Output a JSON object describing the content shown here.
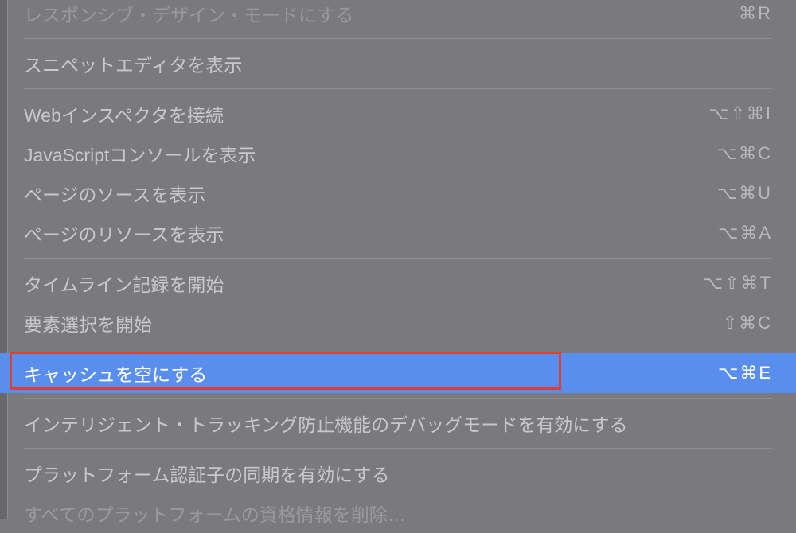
{
  "menu": {
    "items": [
      {
        "label": "レスポンシブ・デザイン・モードにする",
        "shortcut": "⌘R",
        "disabled": true,
        "truncated": true
      },
      {
        "separator": true
      },
      {
        "label": "スニペットエディタを表示",
        "shortcut": ""
      },
      {
        "separator": true
      },
      {
        "label": "Webインスペクタを接続",
        "shortcut": "⌥⇧⌘I"
      },
      {
        "label": "JavaScriptコンソールを表示",
        "shortcut": "⌥⌘C"
      },
      {
        "label": "ページのソースを表示",
        "shortcut": "⌥⌘U"
      },
      {
        "label": "ページのリソースを表示",
        "shortcut": "⌥⌘A"
      },
      {
        "separator": true
      },
      {
        "label": "タイムライン記録を開始",
        "shortcut": "⌥⇧⌘T"
      },
      {
        "label": "要素選択を開始",
        "shortcut": "⇧⌘C"
      },
      {
        "separator": true
      },
      {
        "label": "キャッシュを空にする",
        "shortcut": "⌥⌘E",
        "highlighted": true
      },
      {
        "separator": true
      },
      {
        "label": "インテリジェント・トラッキング防止機能のデバッグモードを有効にする",
        "shortcut": ""
      },
      {
        "separator": true
      },
      {
        "label": "プラットフォーム認証子の同期を有効にする",
        "shortcut": ""
      },
      {
        "label": "すべてのプラットフォームの資格情報を削除…",
        "shortcut": "",
        "disabled": true
      }
    ]
  }
}
